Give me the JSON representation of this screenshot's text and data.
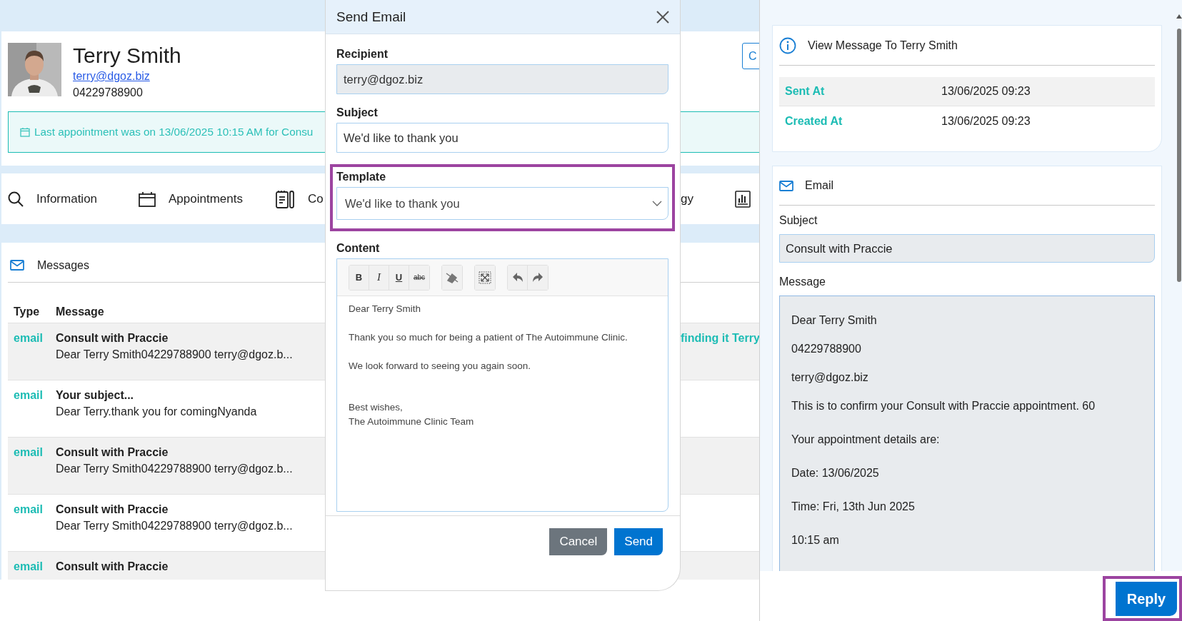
{
  "patient": {
    "name": "Terry Smith",
    "email": "terry@dgoz.biz",
    "phone": "04229788900"
  },
  "header_button": {
    "label": "C"
  },
  "alert": {
    "text": "Last appointment was on 13/06/2025 10:15 AM for Consu"
  },
  "tabs": [
    {
      "label": "Information"
    },
    {
      "label": "Appointments"
    },
    {
      "label": "Co"
    },
    {
      "label": "gy"
    }
  ],
  "messages": {
    "title": "Messages",
    "columns": [
      "Type",
      "Message"
    ],
    "rows": [
      {
        "type": "email",
        "subject": "Consult with Praccie",
        "preview": "Dear Terry Smith04229788900 terry@dgoz.b...",
        "column_3": "finding it Terry"
      },
      {
        "type": "email",
        "subject": "Your subject...",
        "preview": "Dear Terry.thank you for comingNyanda"
      },
      {
        "type": "email",
        "subject": "Consult with Praccie",
        "preview": "Dear Terry Smith04229788900 terry@dgoz.b..."
      },
      {
        "type": "email",
        "subject": "Consult with Praccie",
        "preview": "Dear Terry Smith04229788900 terry@dgoz.b..."
      },
      {
        "type": "email",
        "subject": "Consult with Praccie"
      }
    ]
  },
  "modal": {
    "title": "Send Email",
    "fields": [
      {
        "label": "Recipient",
        "value": "terry@dgoz.biz",
        "kind": "readonly",
        "highlighted": false
      },
      {
        "label": "Subject",
        "value": "We'd like to thank you",
        "kind": "text",
        "highlighted": false
      },
      {
        "label": "Template",
        "value": "We'd like to thank you",
        "kind": "select",
        "highlighted": true
      }
    ],
    "content": {
      "label": "Content",
      "toolbar": [
        [
          {
            "kind": "bold",
            "label": "B"
          },
          {
            "kind": "italic",
            "label": "I"
          },
          {
            "kind": "underline",
            "label": "U"
          },
          {
            "kind": "strike",
            "label": "abc"
          }
        ],
        [
          {
            "kind": "clear"
          }
        ],
        [
          {
            "kind": "fullscreen"
          }
        ],
        [
          {
            "kind": "undo"
          },
          {
            "kind": "redo"
          }
        ]
      ],
      "paragraphs": [
        {
          "lines": [
            "Dear Terry Smith"
          ]
        },
        {
          "lines": [
            "Thank you so much for being a patient of The Autoimmune Clinic."
          ]
        },
        {
          "lines": [
            "We look forward to seeing you again soon."
          ]
        },
        {
          "lines": [
            "Best wishes,",
            "The Autoimmune Clinic Team"
          ]
        }
      ]
    },
    "buttons": [
      {
        "label": "Cancel",
        "kind": "secondary"
      },
      {
        "label": "Send",
        "kind": "primary"
      }
    ]
  },
  "detail": {
    "title": "View Message To Terry Smith",
    "meta": [
      {
        "label": "Sent At",
        "value": "13/06/2025 09:23"
      },
      {
        "label": "Created At",
        "value": "13/06/2025 09:23"
      }
    ],
    "email": {
      "title": "Email",
      "subject_label": "Subject",
      "subject": "Consult with Praccie",
      "message_label": "Message",
      "message_lines": [
        "Dear Terry Smith",
        "04229788900",
        "terry@dgoz.biz",
        "This is to confirm your Consult with Praccie appointment. 60",
        "Your appointment details are:",
        "Date: 13/06/2025",
        "Time: Fri, 13th Jun 2025",
        "10:15 am"
      ]
    }
  },
  "reply_button": {
    "label": "Reply",
    "highlighted": true
  }
}
